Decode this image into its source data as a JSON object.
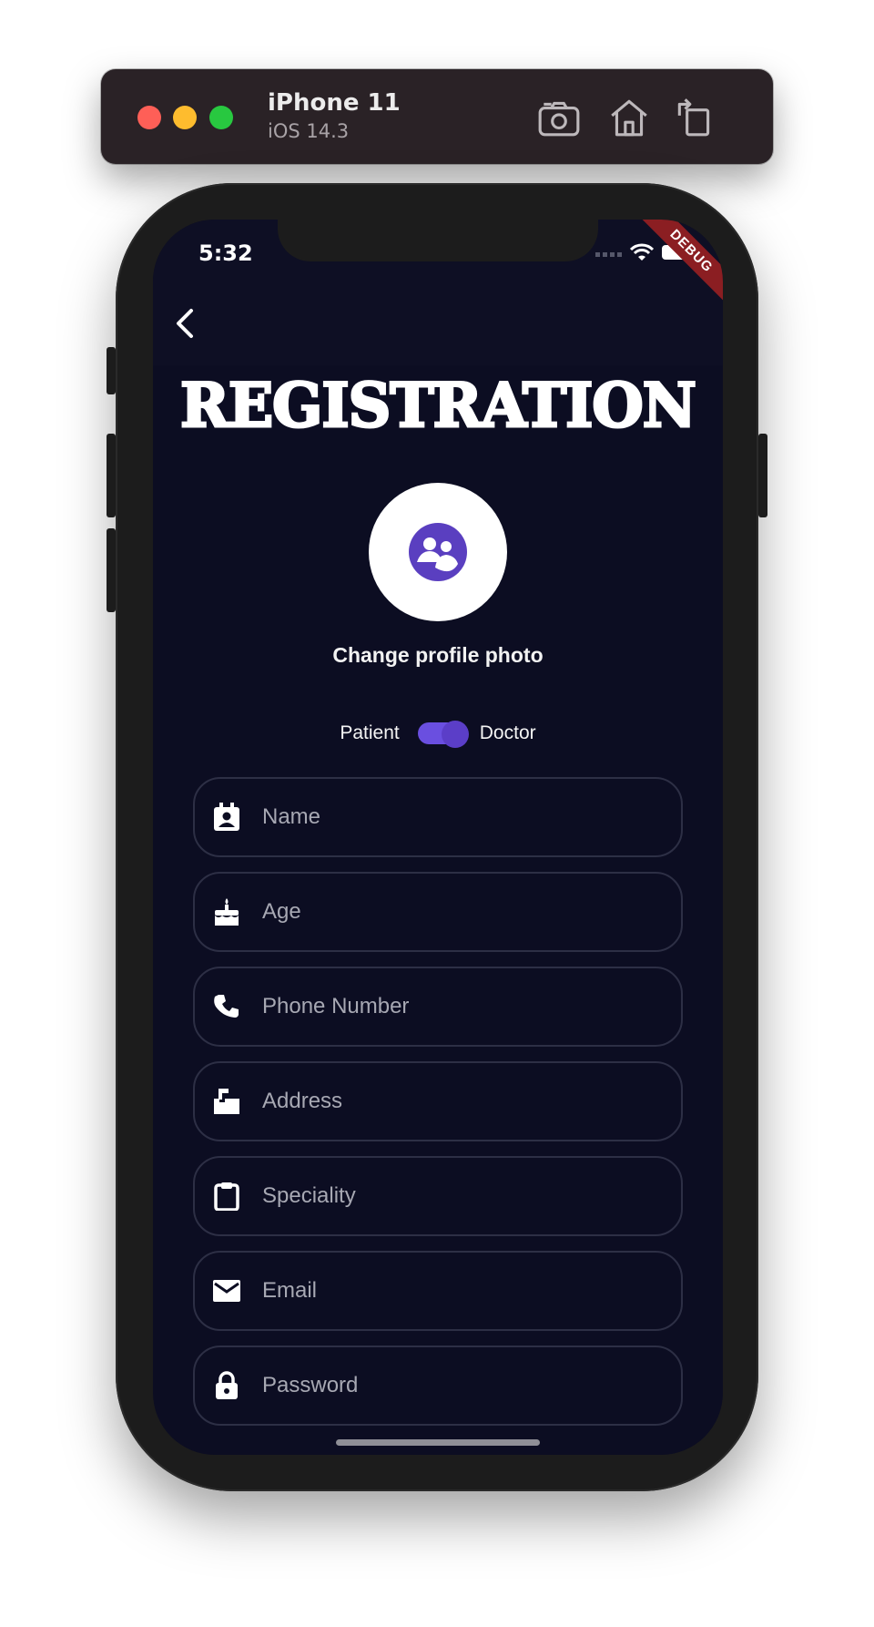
{
  "simulator": {
    "device_name": "iPhone 11",
    "os_version": "iOS 14.3",
    "tools": [
      {
        "icon": "screenshot-icon"
      },
      {
        "icon": "home-icon"
      },
      {
        "icon": "rotate-icon"
      }
    ]
  },
  "status_bar": {
    "time": "5:32",
    "debug_label": "DEBUG"
  },
  "screen": {
    "title": "REGISTRATION",
    "avatar_icon": "profile-group-icon",
    "change_photo_label": "Change profile photo",
    "role_toggle": {
      "left_label": "Patient",
      "right_label": "Doctor",
      "selected": "Doctor"
    },
    "fields": [
      {
        "icon": "contact-card-icon",
        "placeholder": "Name",
        "value": ""
      },
      {
        "icon": "cake-icon",
        "placeholder": "Age",
        "value": ""
      },
      {
        "icon": "phone-icon",
        "placeholder": "Phone Number",
        "value": ""
      },
      {
        "icon": "mailbox-icon",
        "placeholder": "Address",
        "value": ""
      },
      {
        "icon": "clipboard-icon",
        "placeholder": "Speciality",
        "value": ""
      },
      {
        "icon": "email-icon",
        "placeholder": "Email",
        "value": ""
      },
      {
        "icon": "lock-icon",
        "placeholder": "Password",
        "value": ""
      }
    ]
  },
  "colors": {
    "background": "#0c0d22",
    "accent": "#6a4fe0",
    "field_border": "#2d2f45"
  }
}
